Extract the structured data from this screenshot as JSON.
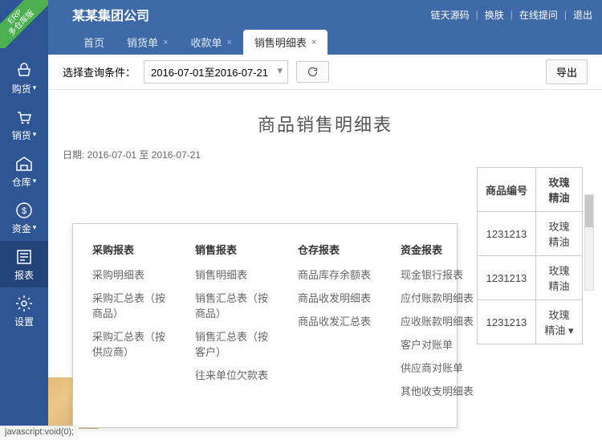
{
  "ribbon": {
    "line1": "ERP",
    "line2": "多仓库版"
  },
  "header": {
    "title": "某某集团公司",
    "links": [
      "链天源码",
      "换肤",
      "在线提问",
      "退出"
    ]
  },
  "tabs": [
    {
      "label": "首页",
      "closable": false
    },
    {
      "label": "销货单",
      "closable": true
    },
    {
      "label": "收款单",
      "closable": true
    },
    {
      "label": "销售明细表",
      "closable": true,
      "active": true
    }
  ],
  "sidebar": [
    {
      "label": "购货",
      "icon": "basket"
    },
    {
      "label": "销货",
      "icon": "cart"
    },
    {
      "label": "仓库",
      "icon": "warehouse"
    },
    {
      "label": "资金",
      "icon": "money"
    },
    {
      "label": "报表",
      "icon": "report",
      "active": true
    },
    {
      "label": "设置",
      "icon": "gear"
    }
  ],
  "toolbar": {
    "filter_label": "选择查询条件：",
    "date_range": "2016-07-01至2016-07-21",
    "export_label": "导出"
  },
  "report": {
    "title": "商品销售明细表",
    "date_label": "日期: 2016-07-01 至 2016-07-21",
    "right_header1": "商品编号",
    "right_header2_prefix": "玫瑰精油",
    "rows": [
      {
        "code": "1231213"
      },
      {
        "code": "1231213"
      },
      {
        "code": "1231213"
      }
    ]
  },
  "mega_menu": {
    "cols": [
      {
        "title": "采购报表",
        "items": [
          "采购明细表",
          "采购汇总表（按商品）",
          "采购汇总表（按供应商）"
        ]
      },
      {
        "title": "销售报表",
        "items": [
          "销售明细表",
          "销售汇总表（按商品）",
          "销售汇总表（按客户）",
          "往来单位欠款表"
        ]
      },
      {
        "title": "仓存报表",
        "items": [
          "商品库存余额表",
          "商品收发明细表",
          "商品收发汇总表"
        ]
      },
      {
        "title": "资金报表",
        "items": [
          "现金银行报表",
          "应付账款明细表",
          "应收账款明细表",
          "客户对账单",
          "供应商对账单",
          "其他收支明细表"
        ]
      }
    ]
  },
  "status": "javascript:void(0);"
}
